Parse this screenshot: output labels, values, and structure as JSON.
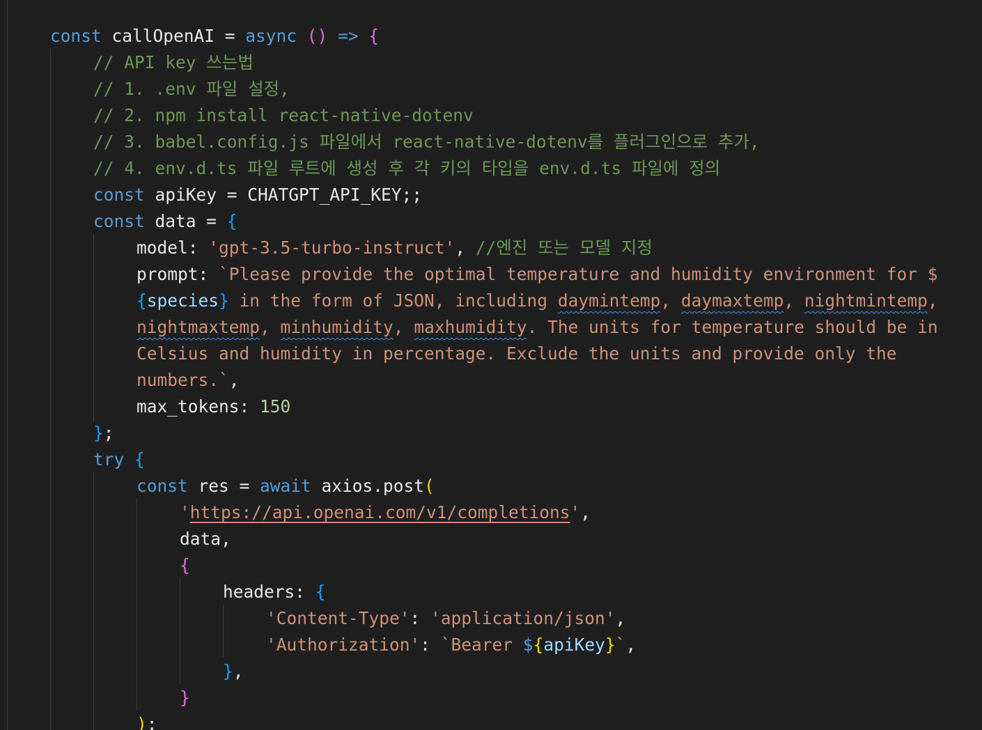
{
  "editor": {
    "theme_colors": {
      "background": "#1f1f1f",
      "keyword": "#569cd6",
      "control": "#c586c0",
      "comment": "#6a9955",
      "string": "#ce9178",
      "number": "#b5cea8",
      "bracket_level1": "#ffd700",
      "bracket_level2": "#da70d6",
      "bracket_level3": "#179fff"
    },
    "code": {
      "l1": {
        "kw": "const",
        "name": " callOpenAI = ",
        "async": "async",
        "parens": " ()",
        "arrow": " =>",
        "brace": " {"
      },
      "l2": {
        "comment": "// API key 쓰는법"
      },
      "l3": {
        "comment": "// 1. .env 파일 설정,"
      },
      "l4": {
        "comment": "// 2. npm install react-native-dotenv"
      },
      "l5": {
        "comment": "// 3. babel.config.js 파일에서 react-native-dotenv를 플러그인으로 추가,"
      },
      "l6": {
        "comment": "// 4. env.d.ts 파일 루트에 생성 후 각 키의 타입을 env.d.ts 파일에 정의"
      },
      "l7": {
        "kw": "const",
        "name": " apiKey = ",
        "value": "CHATGPT_API_KEY",
        "end": ";;"
      },
      "l8": {
        "kw": "const",
        "name": " data = ",
        "brace": "{"
      },
      "l9": {
        "prop": "model: ",
        "str": "'gpt-3.5-turbo-instruct'",
        "comma": ", ",
        "comment": "//엔진 또는 모델 지정"
      },
      "l10": {
        "prop": "prompt: ",
        "str": "`Please provide the optimal temperature and humidity environment for $"
      },
      "l11": {
        "brace_open": "{",
        "expr": "species",
        "brace_close": "}",
        "str1": " in the form of JSON, including ",
        "w1": "daymintemp",
        "sep1": ", ",
        "w2": "daymaxtemp",
        "sep2": ", ",
        "w3": "nightmintemp",
        "sep3": ","
      },
      "l12": {
        "w4": "nightmaxtemp",
        "sep4": ", ",
        "w5": "minhumidity",
        "sep5": ", ",
        "w6": "maxhumidity",
        "str2": ". The units for temperature should be in"
      },
      "l13": {
        "str": "Celsius and humidity in percentage. Exclude the units and provide only the"
      },
      "l14": {
        "str": "numbers.`",
        "comma": ","
      },
      "l15": {
        "prop": "max_tokens: ",
        "num": "150"
      },
      "l16": {
        "brace": "}",
        "end": ";"
      },
      "l17": {
        "kw": "try",
        "brace": " {"
      },
      "l18": {
        "kw": "const",
        "name": " res = ",
        "await": "await",
        "call": " axios.post",
        "paren": "("
      },
      "l19": {
        "q1": "'",
        "url": "https://api.openai.com/v1/completions",
        "q2": "'",
        "comma": ","
      },
      "l20": {
        "text": "data,"
      },
      "l21": {
        "brace": "{"
      },
      "l22": {
        "prop": "headers: ",
        "brace": "{"
      },
      "l23": {
        "key": "'Content-Type'",
        "colon": ": ",
        "val": "'application/json'",
        "comma": ","
      },
      "l24": {
        "key": "'Authorization'",
        "colon": ": ",
        "str1": "`Bearer ",
        "dollar": "$",
        "bo": "{",
        "expr": "apiKey",
        "bc": "}",
        "str2": "`",
        "comma": ","
      },
      "l25": {
        "brace": "}",
        "comma": ","
      },
      "l26": {
        "brace": "}"
      },
      "l27": {
        "paren": ")",
        "end": ";"
      }
    }
  }
}
